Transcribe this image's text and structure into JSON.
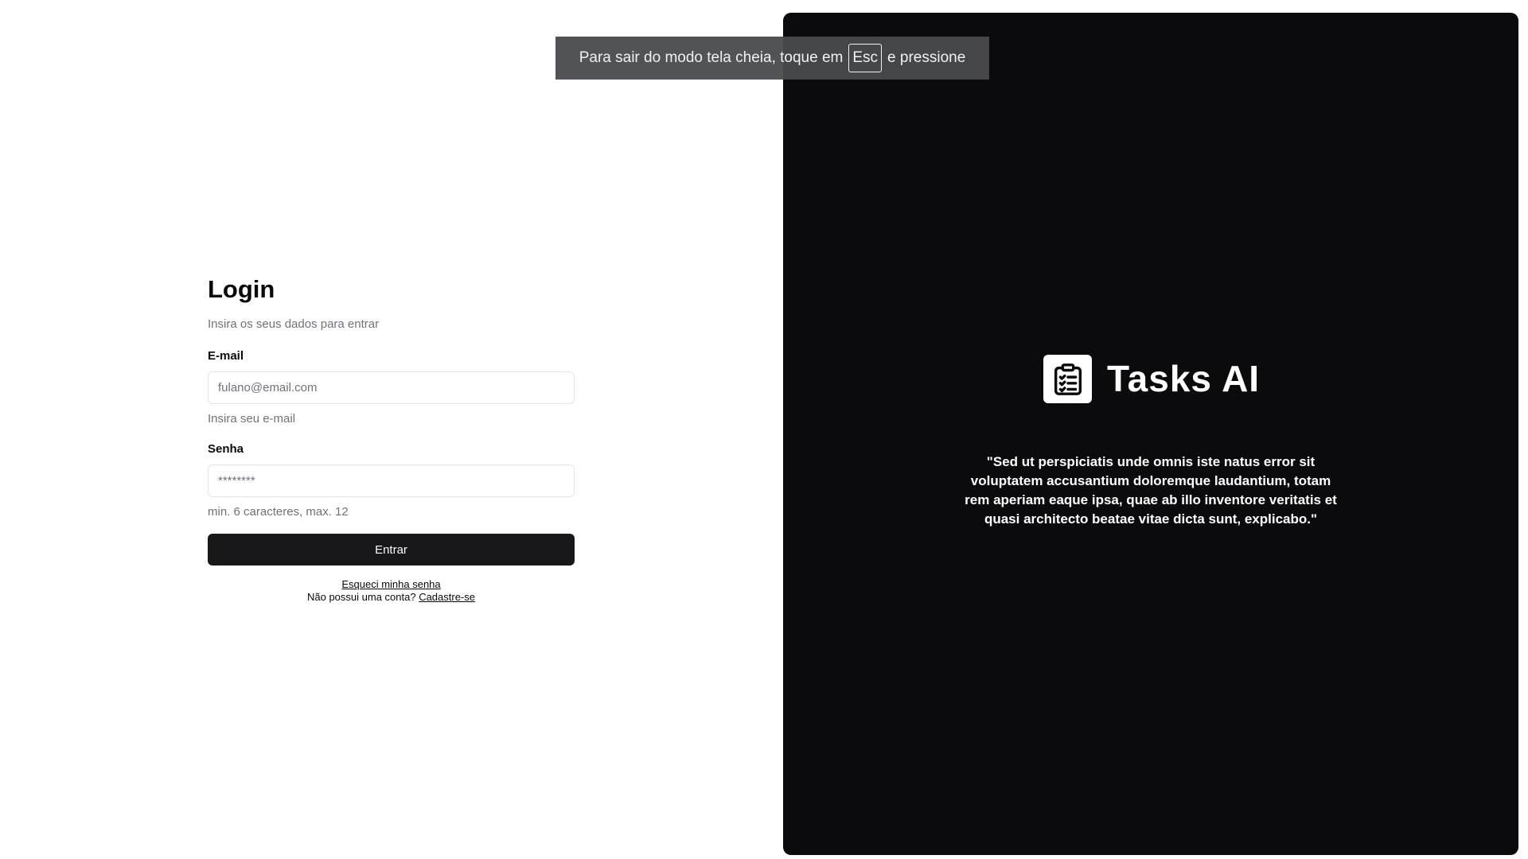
{
  "login": {
    "title": "Login",
    "subtitle": "Insira os seus dados para entrar",
    "email": {
      "label": "E-mail",
      "placeholder": "fulano@email.com",
      "hint": "Insira seu e-mail"
    },
    "password": {
      "label": "Senha",
      "placeholder": "********",
      "hint": "min. 6 caracteres, max. 12"
    },
    "submit_label": "Entrar",
    "forgot_password": "Esqueci minha senha",
    "no_account_prefix": "Não possui uma conta? ",
    "signup_link": "Cadastre-se"
  },
  "brand": {
    "icon": "clipboard-checklist-icon",
    "name": "Tasks AI",
    "quote": "\"Sed ut perspiciatis unde omnis iste natus error sit voluptatem accusantium doloremque laudantium, totam rem aperiam eaque ipsa, quae ab illo inventore veritatis et quasi architecto beatae vitae dicta sunt, explicabo.\""
  },
  "fullscreen_toast": {
    "text_before": "Para sair do modo tela cheia, toque em",
    "key": "Esc",
    "text_after": "e pressione"
  },
  "colors": {
    "primary_button": "#18181b",
    "brand_panel": "#0b0b0d",
    "muted_text": "#71717a"
  }
}
